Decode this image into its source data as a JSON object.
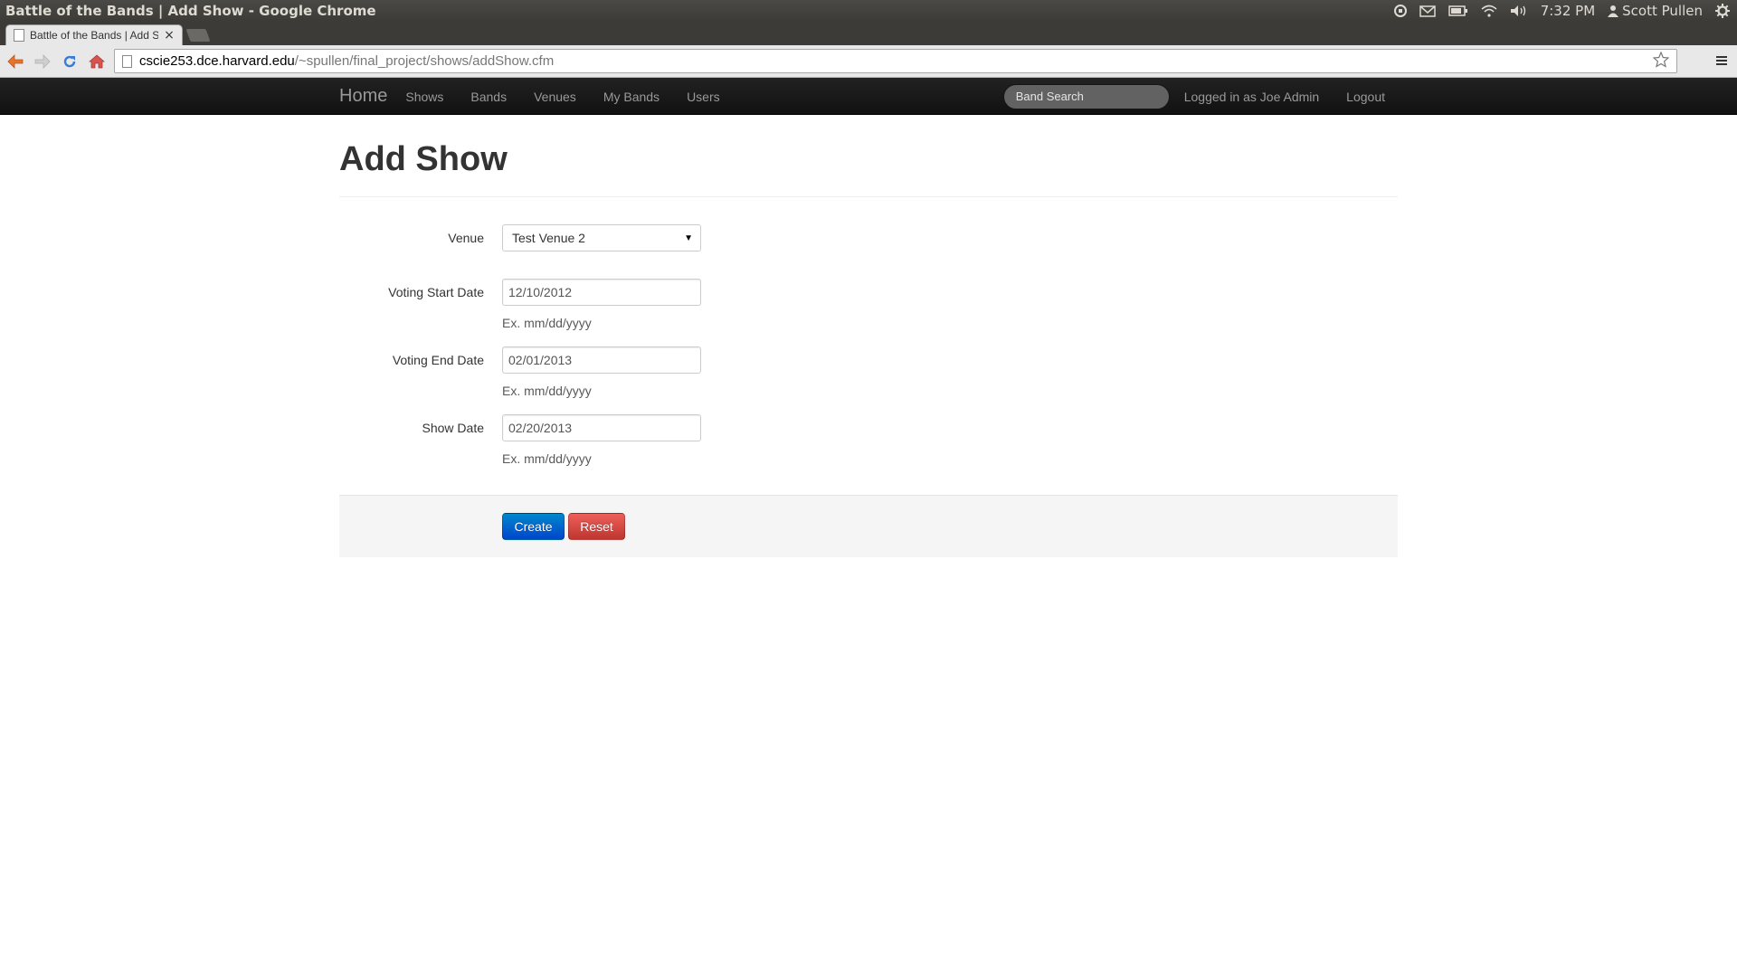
{
  "os_bar": {
    "window_title": "Battle of the Bands | Add Show - Google Chrome",
    "clock": "7:32 PM",
    "user": "Scott Pullen",
    "indicator_icons": [
      "dropbox-icon",
      "mail-icon",
      "battery-icon",
      "wifi-icon",
      "volume-icon",
      "user-icon",
      "gear-icon"
    ]
  },
  "browser": {
    "tab_title": "Battle of the Bands | Add Show",
    "tab_close": "×",
    "url_host": "cscie253.dce.harvard.edu",
    "url_path": "/~spullen/final_project/shows/addShow.cfm"
  },
  "navbar": {
    "brand": "Home",
    "links": [
      "Shows",
      "Bands",
      "Venues",
      "My Bands",
      "Users"
    ],
    "search_placeholder": "Band Search",
    "logged_in_text": "Logged in as Joe Admin",
    "logout": "Logout"
  },
  "page": {
    "title": "Add Show",
    "form": {
      "venue_label": "Venue",
      "venue_value": "Test Venue 2",
      "voting_start_label": "Voting Start Date",
      "voting_start_value": "12/10/2012",
      "voting_start_help": "Ex. mm/dd/yyyy",
      "voting_end_label": "Voting End Date",
      "voting_end_value": "02/01/2013",
      "voting_end_help": "Ex. mm/dd/yyyy",
      "show_date_label": "Show Date",
      "show_date_value": "02/20/2013",
      "show_date_help": "Ex. mm/dd/yyyy"
    },
    "buttons": {
      "create": "Create",
      "reset": "Reset"
    }
  },
  "colors": {
    "navbar_bg": "#1b1b1b",
    "create_button": "#0055cc",
    "reset_button": "#d9534f"
  }
}
